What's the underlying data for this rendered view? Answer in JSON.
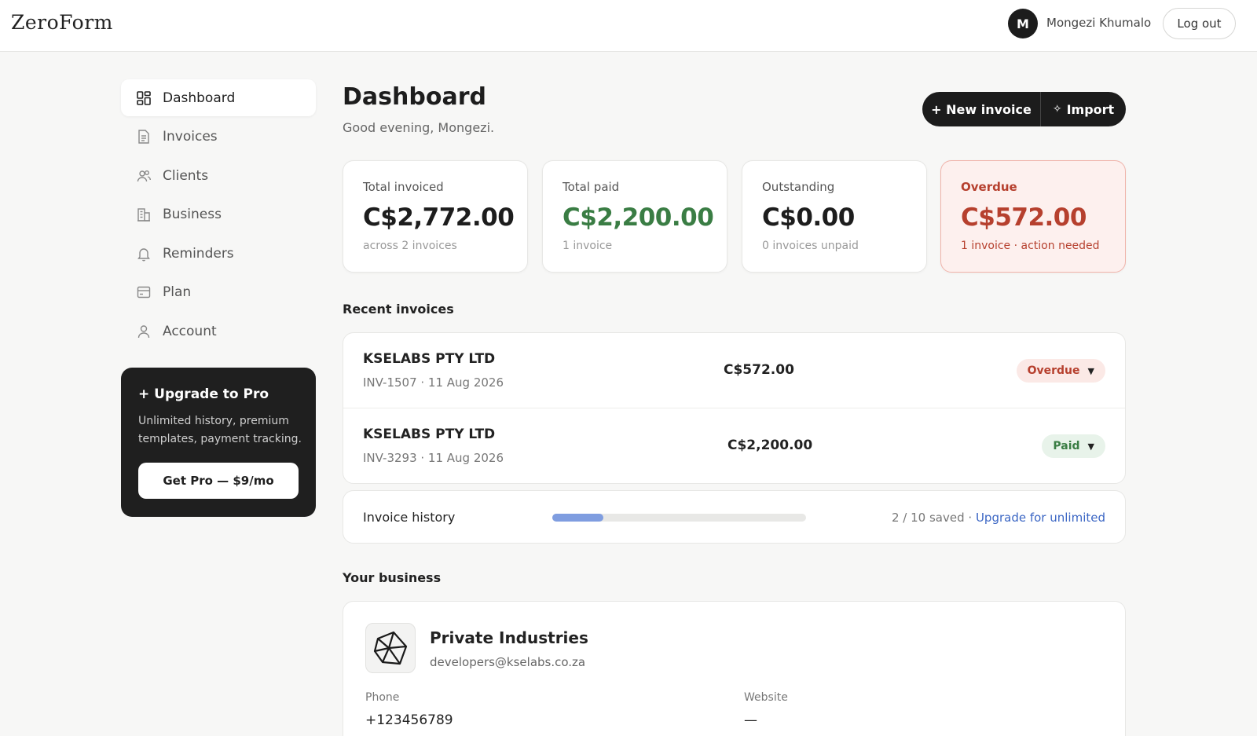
{
  "app": {
    "logo_text": "ZeroForm"
  },
  "user": {
    "initial": "M",
    "name": "Mongezi Khumalo",
    "logout_label": "Log out"
  },
  "sidebar": {
    "items": [
      {
        "label": "Dashboard",
        "icon": "dashboard-icon",
        "active": true
      },
      {
        "label": "Invoices",
        "icon": "document-icon",
        "active": false
      },
      {
        "label": "Clients",
        "icon": "users-icon",
        "active": false
      },
      {
        "label": "Business",
        "icon": "building-icon",
        "active": false
      },
      {
        "label": "Reminders",
        "icon": "bell-icon",
        "active": false
      },
      {
        "label": "Plan",
        "icon": "card-icon",
        "active": false
      },
      {
        "label": "Account",
        "icon": "user-icon",
        "active": false
      }
    ],
    "upgrade": {
      "title": "+ Upgrade to Pro",
      "description": "Unlimited history, premium templates, payment tracking.",
      "button_label": "Get Pro — $9/mo"
    }
  },
  "header": {
    "title": "Dashboard",
    "greeting": "Good evening, Mongezi.",
    "new_invoice_label": "+ New invoice",
    "import_label": "Import"
  },
  "stats": {
    "total_invoiced": {
      "label": "Total invoiced",
      "value": "C$2,772.00",
      "sub": "across 2 invoices"
    },
    "total_paid": {
      "label": "Total paid",
      "value": "C$2,200.00",
      "sub": "1 invoice"
    },
    "outstanding": {
      "label": "Outstanding",
      "value": "C$0.00",
      "sub": "0 invoices unpaid"
    },
    "overdue": {
      "label": "Overdue",
      "value": "C$572.00",
      "sub": "1 invoice · action needed"
    }
  },
  "recent_invoices": {
    "title": "Recent invoices",
    "rows": [
      {
        "client": "KSELABS PTY LTD",
        "meta": "INV-1507 · 11 Aug 2026",
        "amount": "C$572.00",
        "status": "Overdue"
      },
      {
        "client": "KSELABS PTY LTD",
        "meta": "INV-3293 · 11 Aug 2026",
        "amount": "C$2,200.00",
        "status": "Paid"
      }
    ]
  },
  "history": {
    "label": "Invoice history",
    "saved_text": "2 / 10 saved · ",
    "upgrade_link": "Upgrade for unlimited",
    "used": 2,
    "limit": 10
  },
  "business": {
    "section_title": "Your business",
    "name": "Private Industries",
    "email": "developers@kselabs.co.za",
    "phone_label": "Phone",
    "phone_value": "+123456789",
    "website_label": "Website",
    "website_value": "—"
  },
  "colors": {
    "accent_dark": "#1c1c1c",
    "paid_green": "#3a7d44",
    "overdue_red": "#b6402e",
    "link_blue": "#3b66c4",
    "progress_blue": "#7f9de0"
  }
}
